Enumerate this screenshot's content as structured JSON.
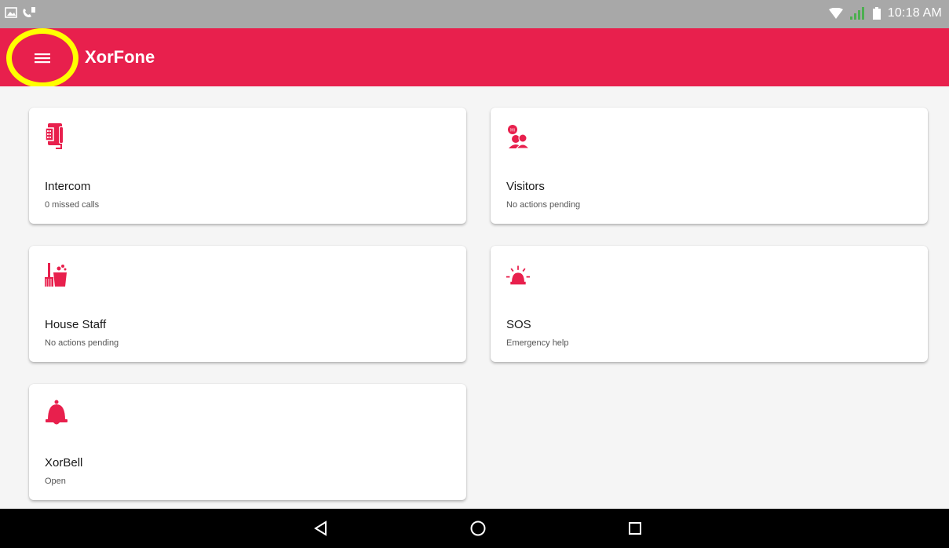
{
  "status_bar": {
    "time": "10:18 AM"
  },
  "app_bar": {
    "title": "XorFone"
  },
  "colors": {
    "accent": "#e8204d",
    "highlight": "#ffff00"
  },
  "cards": [
    {
      "title": "Intercom",
      "subtitle": "0 missed calls",
      "icon": "intercom-phone-icon"
    },
    {
      "title": "Visitors",
      "subtitle": "No actions pending",
      "icon": "visitors-icon"
    },
    {
      "title": "House Staff",
      "subtitle": "No actions pending",
      "icon": "house-staff-icon"
    },
    {
      "title": "SOS",
      "subtitle": "Emergency help",
      "icon": "siren-icon"
    },
    {
      "title": "XorBell",
      "subtitle": "Open",
      "icon": "bell-icon"
    }
  ]
}
